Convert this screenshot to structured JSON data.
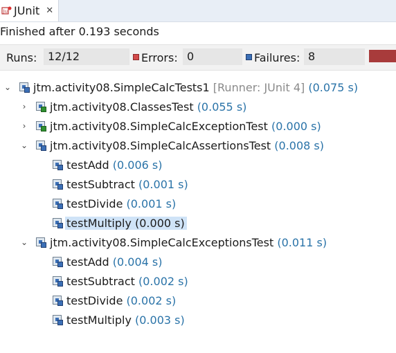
{
  "tab": {
    "label": "JUnit",
    "close": "✕"
  },
  "status": "Finished after 0.193 seconds",
  "counters": {
    "runs_label": "Runs:",
    "runs_value": "12/12",
    "errors_label": "Errors:",
    "errors_value": "0",
    "failures_label": "Failures:",
    "failures_value": "8"
  },
  "tree": {
    "root": {
      "name": "jtm.activity08.SimpleCalcTests1",
      "runner": "[Runner: JUnit 4]",
      "time": "(0.075 s)"
    },
    "suites": [
      {
        "name": "jtm.activity08.ClassesTest",
        "time": "(0.055 s)",
        "expanded": false,
        "status": "pass"
      },
      {
        "name": "jtm.activity08.SimpleCalcExceptionTest",
        "time": "(0.000 s)",
        "expanded": false,
        "status": "pass"
      },
      {
        "name": "jtm.activity08.SimpleCalcAssertionsTest",
        "time": "(0.008 s)",
        "expanded": true,
        "status": "fail",
        "tests": [
          {
            "name": "testAdd",
            "time": "(0.006 s)"
          },
          {
            "name": "testSubtract",
            "time": "(0.001 s)"
          },
          {
            "name": "testDivide",
            "time": "(0.001 s)"
          },
          {
            "name": "testMultiply",
            "time": "(0.000 s)",
            "selected": true
          }
        ]
      },
      {
        "name": "jtm.activity08.SimpleCalcExceptionsTest",
        "time": "(0.011 s)",
        "expanded": true,
        "status": "fail",
        "tests": [
          {
            "name": "testAdd",
            "time": "(0.004 s)"
          },
          {
            "name": "testSubtract",
            "time": "(0.002 s)"
          },
          {
            "name": "testDivide",
            "time": "(0.002 s)"
          },
          {
            "name": "testMultiply",
            "time": "(0.003 s)"
          }
        ]
      }
    ]
  }
}
